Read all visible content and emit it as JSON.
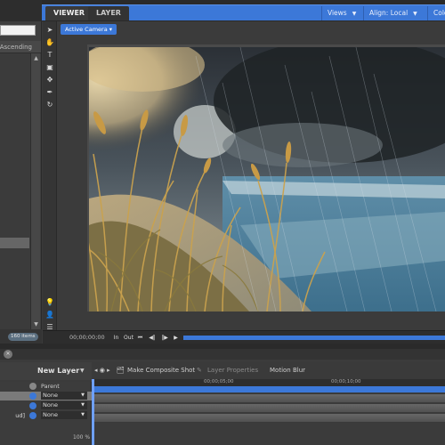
{
  "left_panel": {
    "sort_label": "Ascending",
    "items_count": "160 items"
  },
  "tabs": [
    {
      "label": "VIEWER",
      "active": true
    },
    {
      "label": "LAYER",
      "active": false
    }
  ],
  "viewer_toolbar": {
    "views_label": "Views",
    "align_label": "Align: Local",
    "extra_label": "Colo"
  },
  "viewer": {
    "camera_label": "Active Camera"
  },
  "transport": {
    "timecode": "00;00;00;00",
    "in_label": "In",
    "out_label": "Out"
  },
  "timeline": {
    "new_layer_label": "New Layer",
    "make_composite_label": "Make Composite Shot",
    "layer_properties_label": "Layer Properties",
    "motion_blur_label": "Motion Blur",
    "parent_label": "Parent",
    "ruler_labels": [
      "00;00;05;00",
      "00;00;10;00"
    ],
    "zoom_label": "100 %",
    "layers": [
      {
        "name": "",
        "parent": "None"
      },
      {
        "name": "",
        "parent": "None"
      },
      {
        "name": "ud]",
        "parent": "None"
      }
    ]
  },
  "colors": {
    "accent": "#3c78d8",
    "panel_bg": "#3b3b3b",
    "dark_bg": "#2a2a2a"
  }
}
